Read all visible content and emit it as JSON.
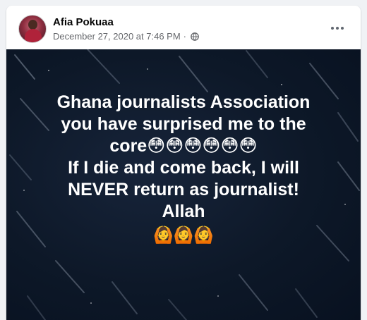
{
  "post": {
    "author": "Afia Pokuaa",
    "timestamp": "December 27, 2020 at 7:46 PM",
    "separator": "·",
    "privacy_icon": "globe-icon",
    "more_icon": "more-options-icon",
    "text_lines": [
      "Ghana journalists Association",
      "you have surprised me to the",
      "core😳😳😳😳😳😳",
      "If I die and come back, I will",
      "NEVER return as journalist!",
      "Allah"
    ],
    "emoji_line": "🙆🙆🙆"
  },
  "colors": {
    "image_background": "#0d1828",
    "text": "#ffffff",
    "meta": "#65676b",
    "page_bg": "#f0f2f5"
  }
}
